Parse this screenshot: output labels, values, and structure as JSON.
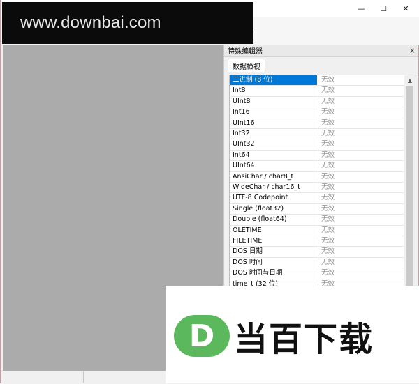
{
  "window": {
    "controls": {
      "minimize": "—",
      "maximize": "☐",
      "close": "✕"
    }
  },
  "watermark": {
    "url_text": "www.downbai.com",
    "logo_letter": "D",
    "logo_text": "当百下载",
    "logo_color": "#5cb85c"
  },
  "panel": {
    "title": "特殊编辑器",
    "close_glyph": "×",
    "tab": "数据检视",
    "rows": [
      {
        "name": "二进制 (8 位)",
        "value": "无效",
        "selected": true
      },
      {
        "name": "Int8",
        "value": "无效"
      },
      {
        "name": "UInt8",
        "value": "无效"
      },
      {
        "name": "Int16",
        "value": "无效"
      },
      {
        "name": "UInt16",
        "value": "无效"
      },
      {
        "name": "Int32",
        "value": "无效"
      },
      {
        "name": "UInt32",
        "value": "无效"
      },
      {
        "name": "Int64",
        "value": "无效"
      },
      {
        "name": "UInt64",
        "value": "无效"
      },
      {
        "name": "AnsiChar / char8_t",
        "value": "无效"
      },
      {
        "name": "WideChar / char16_t",
        "value": "无效"
      },
      {
        "name": "UTF-8 Codepoint",
        "value": "无效"
      },
      {
        "name": "Single (float32)",
        "value": "无效"
      },
      {
        "name": "Double (float64)",
        "value": "无效"
      },
      {
        "name": "OLETIME",
        "value": "无效"
      },
      {
        "name": "FILETIME",
        "value": "无效"
      },
      {
        "name": "DOS 日期",
        "value": "无效"
      },
      {
        "name": "DOS 时间",
        "value": "无效"
      },
      {
        "name": "DOS 时间与日期",
        "value": "无效"
      },
      {
        "name": "time_t (32 位)",
        "value": "无效"
      }
    ],
    "selection_color": "#0078d7"
  }
}
